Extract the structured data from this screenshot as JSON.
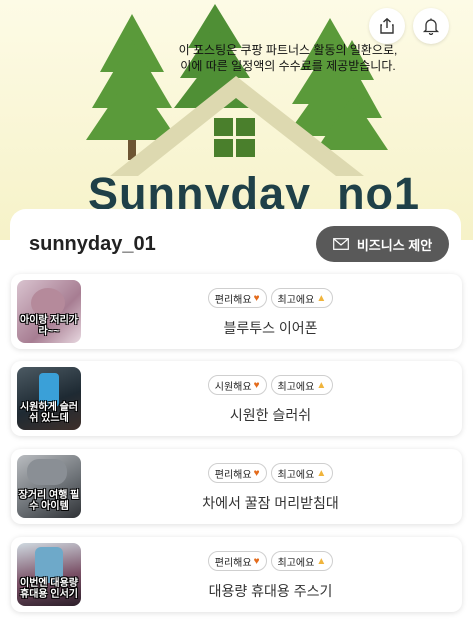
{
  "header": {
    "disclosure_line1": "이 포스팅은 쿠팡 파트너스 활동의 일환으로,",
    "disclosure_line2": "이에 따른 일정액의 수수료를 제공받습니다.",
    "brand": "Sunnyday_no1",
    "share_icon": "share-icon",
    "bell_icon": "bell-icon"
  },
  "profile": {
    "name": "sunnyday_01",
    "business_button_label": "비즈니스 제안",
    "business_icon": "envelope-icon"
  },
  "products": [
    {
      "thumb_caption": "아이랑 저리가라~~",
      "tags": [
        "편리해요",
        "최고에요"
      ],
      "title": "블루투스 이어폰"
    },
    {
      "thumb_caption": "시원하게 슬러쉬 있느데",
      "tags": [
        "시원해요",
        "최고에요"
      ],
      "title": "시원한 슬러쉬"
    },
    {
      "thumb_caption": "장거리 여행 필수 아이템",
      "tags": [
        "편리해요",
        "최고에요"
      ],
      "title": "차에서 꿀잠 머리받침대"
    },
    {
      "thumb_caption": "이번엔 대용량 휴대용 인서기",
      "tags": [
        "편리해요",
        "최고에요"
      ],
      "title": "대용량 휴대용 주스기"
    }
  ],
  "colors": {
    "accent_button": "#595959",
    "tree_green": "#5a9a3a",
    "brand_text": "#1f4048",
    "heart": "#e36b1c",
    "thumbs": "#f0b43c"
  }
}
